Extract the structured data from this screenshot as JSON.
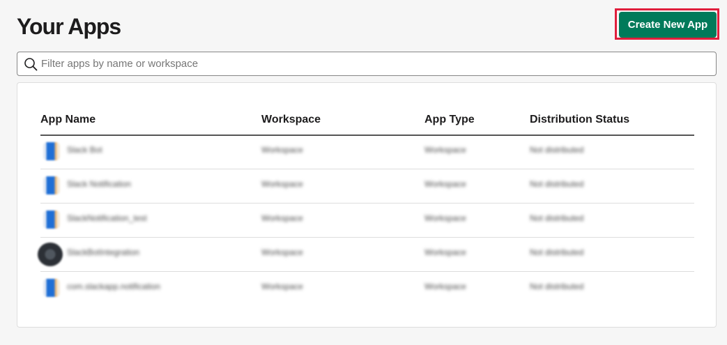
{
  "header": {
    "title": "Your Apps",
    "create_button_label": "Create New App"
  },
  "search": {
    "placeholder": "Filter apps by name or workspace",
    "value": ""
  },
  "table": {
    "columns": {
      "app_name": "App Name",
      "workspace": "Workspace",
      "app_type": "App Type",
      "distribution_status": "Distribution Status"
    },
    "rows": [
      {
        "name": "Slack Bot",
        "workspace": "Workspace",
        "type": "Workspace",
        "status": "Not distributed",
        "icon": "app-icon-blue"
      },
      {
        "name": "Slack Notification",
        "workspace": "Workspace",
        "type": "Workspace",
        "status": "Not distributed",
        "icon": "app-icon-blue"
      },
      {
        "name": "SlackNotification_test",
        "workspace": "Workspace",
        "type": "Workspace",
        "status": "Not distributed",
        "icon": "app-icon-blue"
      },
      {
        "name": "SlackBotIntegration",
        "workspace": "Workspace",
        "type": "Workspace",
        "status": "Not distributed",
        "icon": "app-icon-dark"
      },
      {
        "name": "com.slackapp.notification",
        "workspace": "Workspace",
        "type": "Workspace",
        "status": "Not distributed",
        "icon": "app-icon-blue"
      }
    ]
  },
  "colors": {
    "primary_button": "#007a5a",
    "highlight_border": "#e01e3c",
    "background": "#f6f6f6"
  }
}
